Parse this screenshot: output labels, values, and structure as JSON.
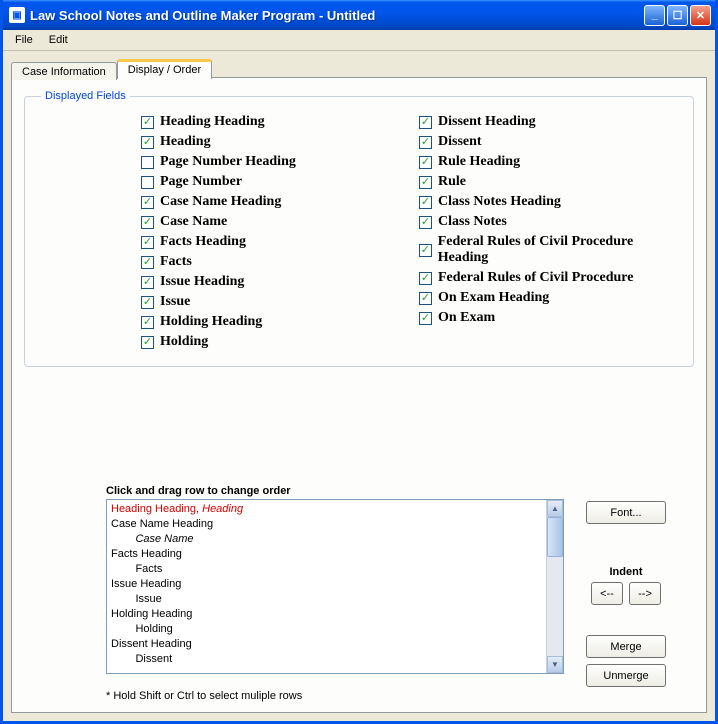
{
  "window": {
    "title": "Law School Notes and Outline Maker Program - Untitled"
  },
  "menu": {
    "file": "File",
    "edit": "Edit"
  },
  "tabs": {
    "case_info": "Case Information",
    "display_order": "Display / Order"
  },
  "group": {
    "legend": "Displayed Fields"
  },
  "fields_left": [
    {
      "label": "Heading Heading",
      "checked": true
    },
    {
      "label": "Heading",
      "checked": true
    },
    {
      "label": "Page Number Heading",
      "checked": false
    },
    {
      "label": "Page Number",
      "checked": false
    },
    {
      "label": "Case Name Heading",
      "checked": true
    },
    {
      "label": "Case Name",
      "checked": true
    },
    {
      "label": "Facts Heading",
      "checked": true
    },
    {
      "label": "Facts",
      "checked": true
    },
    {
      "label": "Issue Heading",
      "checked": true
    },
    {
      "label": "Issue",
      "checked": true
    },
    {
      "label": "Holding Heading",
      "checked": true
    },
    {
      "label": "Holding",
      "checked": true
    }
  ],
  "fields_right": [
    {
      "label": "Dissent Heading",
      "checked": true
    },
    {
      "label": "Dissent",
      "checked": true
    },
    {
      "label": "Rule Heading",
      "checked": true
    },
    {
      "label": "Rule",
      "checked": true
    },
    {
      "label": "Class Notes Heading",
      "checked": true
    },
    {
      "label": "Class Notes",
      "checked": true
    },
    {
      "label": "Federal Rules of Civil Procedure Heading",
      "checked": true
    },
    {
      "label": "Federal Rules of Civil Procedure",
      "checked": true
    },
    {
      "label": "On Exam Heading",
      "checked": true
    },
    {
      "label": "On Exam",
      "checked": true
    }
  ],
  "order": {
    "heading": "Click and drag row to change order",
    "hint": "* Hold Shift or Ctrl to select muliple rows",
    "items": [
      {
        "text": "Heading Heading, Heading",
        "selected": true,
        "indent": 0,
        "italic_tail": "Heading"
      },
      {
        "text": "Case Name Heading",
        "indent": 0
      },
      {
        "text": "Case Name",
        "indent": 1,
        "italic": true
      },
      {
        "text": "Facts Heading",
        "indent": 0
      },
      {
        "text": "Facts",
        "indent": 1
      },
      {
        "text": "Issue Heading",
        "indent": 0
      },
      {
        "text": "Issue",
        "indent": 1
      },
      {
        "text": "Holding Heading",
        "indent": 0
      },
      {
        "text": "Holding",
        "indent": 1
      },
      {
        "text": "Dissent Heading",
        "indent": 0
      },
      {
        "text": "Dissent",
        "indent": 1
      }
    ]
  },
  "buttons": {
    "font": "Font...",
    "indent_label": "Indent",
    "indent_left": "<--",
    "indent_right": "-->",
    "merge": "Merge",
    "unmerge": "Unmerge"
  }
}
